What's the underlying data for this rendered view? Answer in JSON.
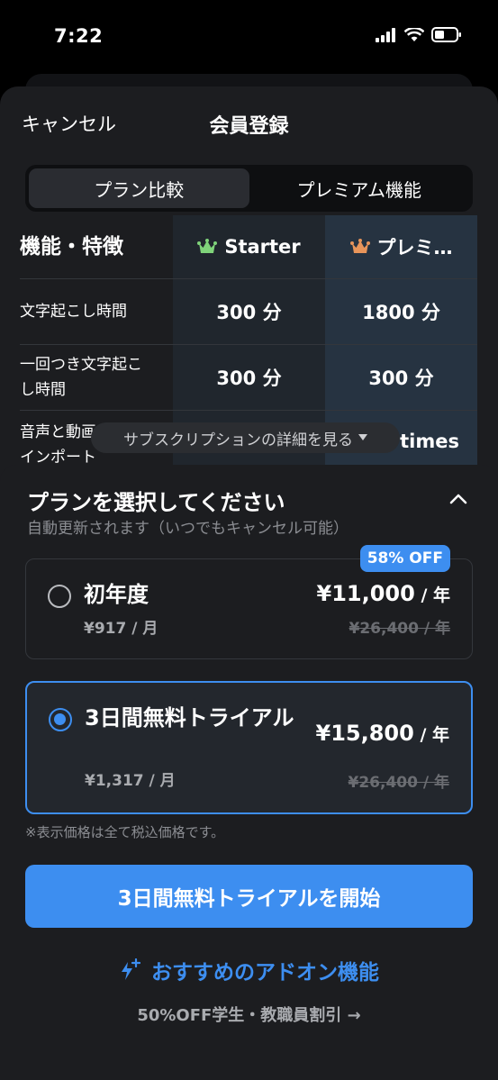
{
  "status_bar": {
    "time": "7:22"
  },
  "nav": {
    "cancel_label": "キャンセル",
    "title": "会員登録"
  },
  "tabs": [
    {
      "label": "プラン比較",
      "active": true
    },
    {
      "label": "プレミアム機能",
      "active": false
    }
  ],
  "comparison": {
    "header": {
      "feature_label": "機能・特徴",
      "starter": "Starter",
      "premium": "プレミ…"
    },
    "rows": [
      {
        "feature": "文字起こし時間",
        "starter": "300 分",
        "premium": "1800 分"
      },
      {
        "feature": "一回つき文字起こし時間",
        "starter": "300 分",
        "premium": "300 分"
      },
      {
        "feature": "音声と動画インポート",
        "starter": "",
        "premium": "times"
      }
    ],
    "details_link": "サブスクリプションの詳細を見る"
  },
  "plan_select": {
    "title": "プランを選択してください",
    "subtitle": "自動更新されます（いつでもキャンセル可能）",
    "plans": [
      {
        "name": "初年度",
        "monthly": "¥917 / 月",
        "price": "¥11,000",
        "price_unit": " / 年",
        "original": "¥26,400 / 年",
        "badge": "58% OFF",
        "selected": false
      },
      {
        "name": "3日間無料トライアル",
        "monthly": "¥1,317 / 月",
        "price": "¥15,800",
        "price_unit": " / 年",
        "original": "¥26,400 / 年",
        "selected": true
      }
    ],
    "tax_note": "※表示価格は全て税込価格です。",
    "cta_label": "3日間無料トライアルを開始",
    "addon_label": "おすすめのアドオン機能",
    "discount_label": "50%OFF学生・教職員割引 →"
  },
  "colors": {
    "accent": "#3d8ef0",
    "starter_icon": "#7fd37a",
    "premium_icon": "#e8955a"
  }
}
